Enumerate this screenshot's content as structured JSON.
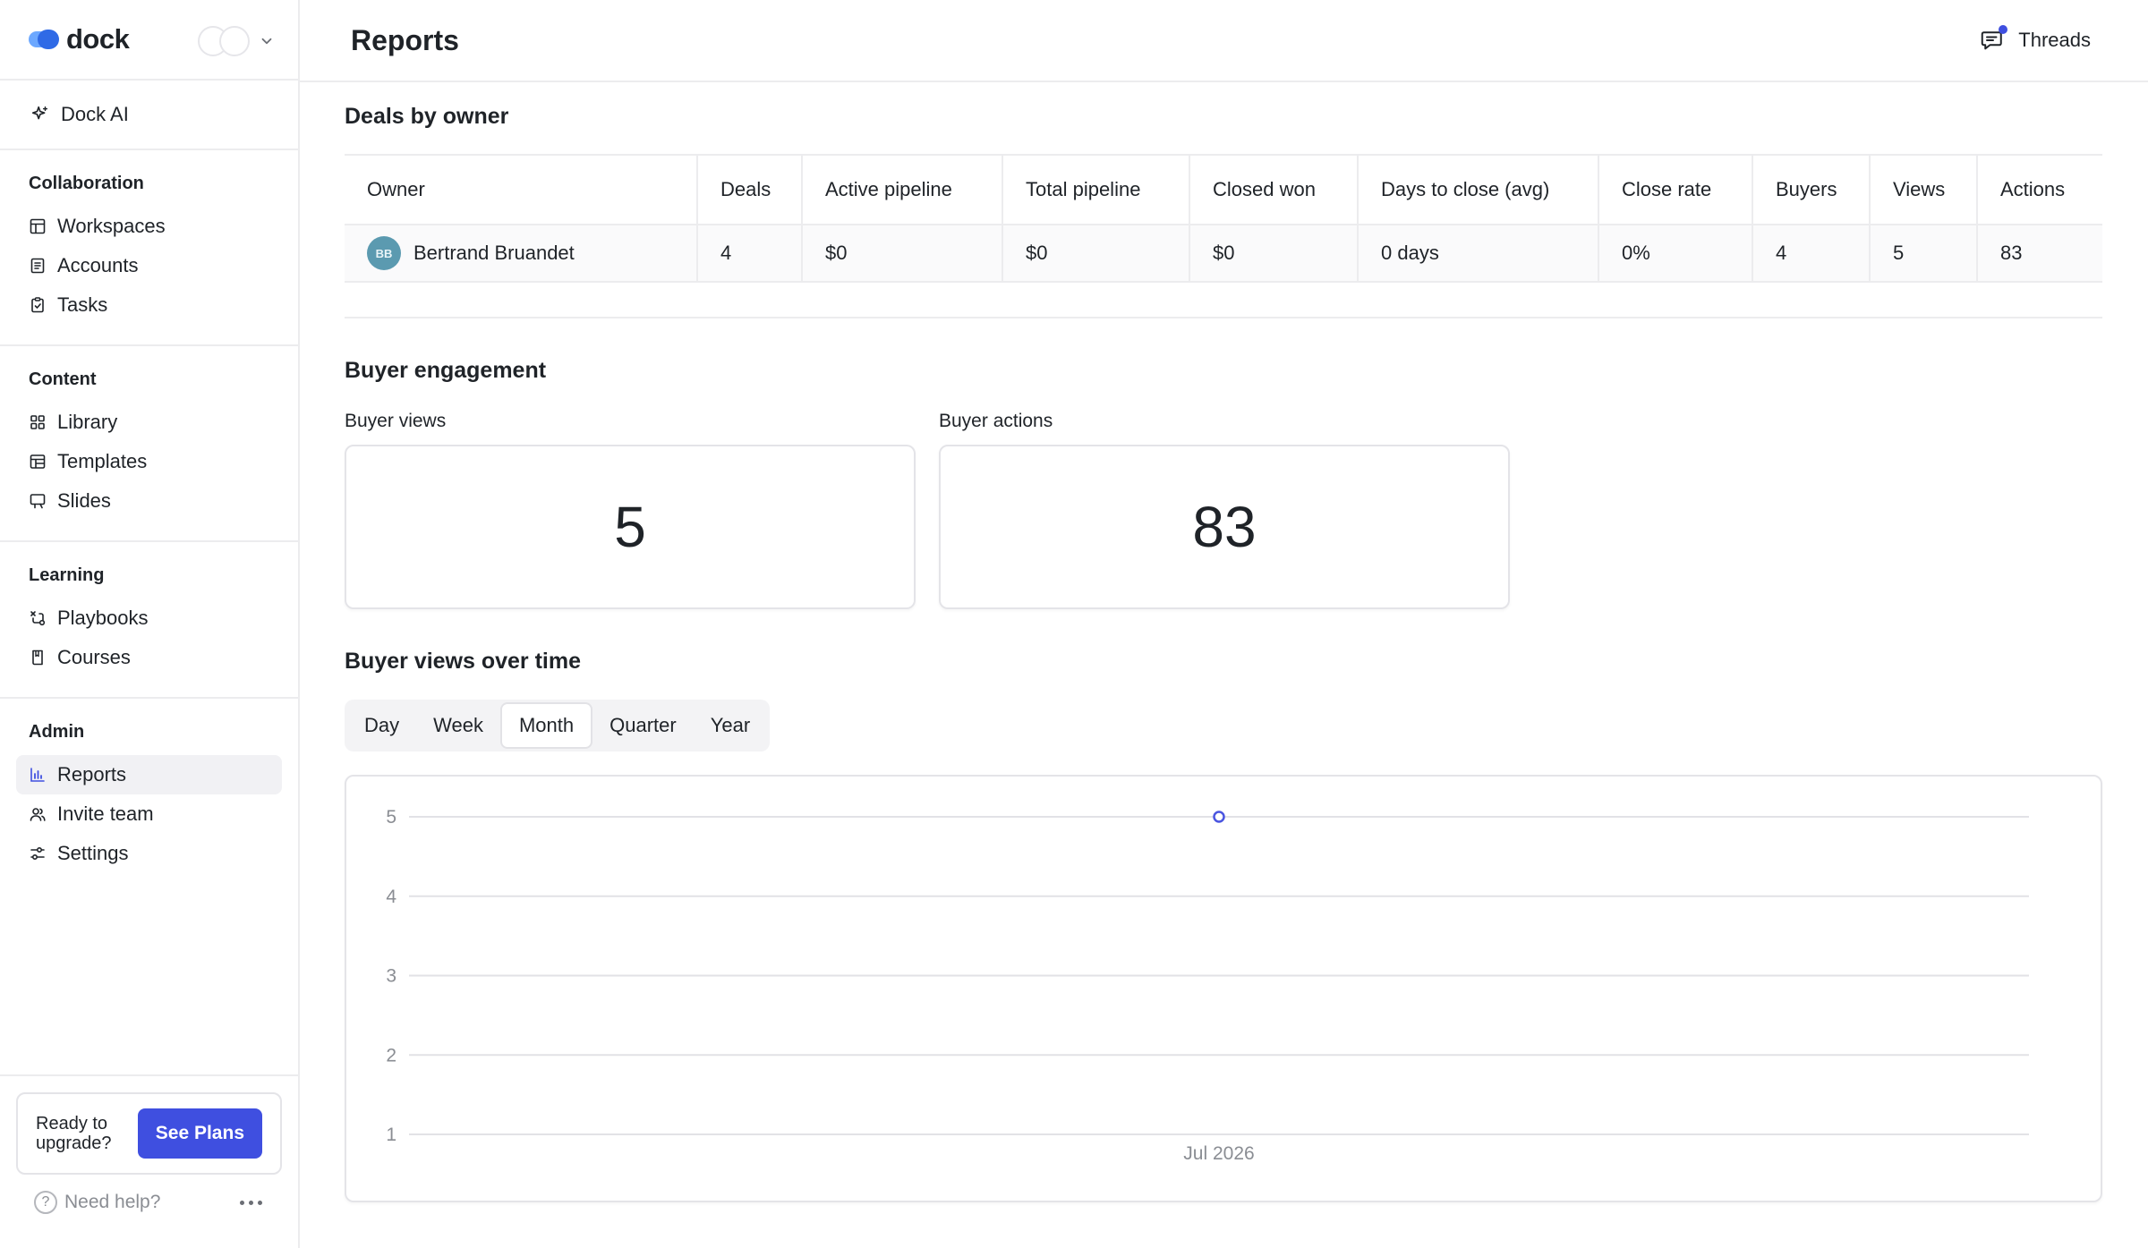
{
  "brand": {
    "name": "dock"
  },
  "nav": {
    "ai_label": "Dock AI",
    "sections": [
      {
        "title": "Collaboration",
        "items": [
          "Workspaces",
          "Accounts",
          "Tasks"
        ]
      },
      {
        "title": "Content",
        "items": [
          "Library",
          "Templates",
          "Slides"
        ]
      },
      {
        "title": "Learning",
        "items": [
          "Playbooks",
          "Courses"
        ]
      },
      {
        "title": "Admin",
        "items": [
          "Reports",
          "Invite team",
          "Settings"
        ],
        "active": "Reports"
      }
    ]
  },
  "upgrade": {
    "text": "Ready to upgrade?",
    "button": "See Plans"
  },
  "help": {
    "label": "Need help?"
  },
  "header": {
    "title": "Reports",
    "threads_label": "Threads"
  },
  "deals": {
    "title": "Deals by owner",
    "columns": [
      "Owner",
      "Deals",
      "Active pipeline",
      "Total pipeline",
      "Closed won",
      "Days to close (avg)",
      "Close rate",
      "Buyers",
      "Views",
      "Actions"
    ],
    "rows": [
      {
        "initials": "BB",
        "owner": "Bertrand Bruandet",
        "deals": "4",
        "active_pipeline": "$0",
        "total_pipeline": "$0",
        "closed_won": "$0",
        "days_to_close": "0 days",
        "close_rate": "0%",
        "buyers": "4",
        "views": "5",
        "actions": "83"
      }
    ]
  },
  "engagement": {
    "title": "Buyer engagement",
    "views_label": "Buyer views",
    "views_value": "5",
    "actions_label": "Buyer actions",
    "actions_value": "83"
  },
  "views_over_time": {
    "title": "Buyer views over time",
    "periods": [
      "Day",
      "Week",
      "Month",
      "Quarter",
      "Year"
    ],
    "selected_period": "Month"
  },
  "colors": {
    "accent": "#3f4fe0",
    "point": "#4a55e0",
    "grid": "#e2e2e6",
    "avatar": "#5b9ab0"
  },
  "chart_data": {
    "type": "line",
    "x": [
      "Jul 2026"
    ],
    "series": [
      {
        "values": [
          5
        ]
      }
    ],
    "yticks": [
      1,
      2,
      3,
      4,
      5
    ],
    "ylim": [
      1,
      5
    ],
    "grid": true
  }
}
